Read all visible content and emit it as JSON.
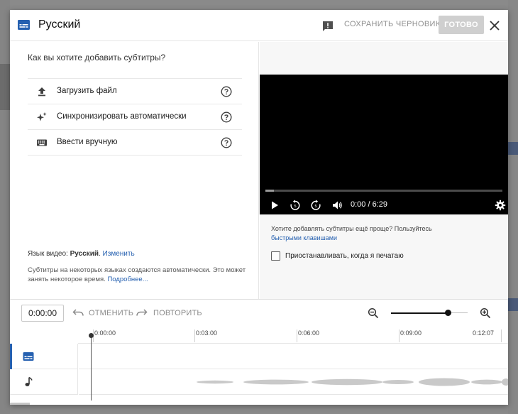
{
  "header": {
    "title": "Русский",
    "save_draft_label": "СОХРАНИТЬ ЧЕРНОВИК",
    "done_label": "ГОТОВО"
  },
  "left_pane": {
    "question": "Как вы хотите добавить субтитры?",
    "options": [
      {
        "label": "Загрузить файл",
        "icon": "upload-icon"
      },
      {
        "label": "Синхронизировать автоматически",
        "icon": "sparkle-icon"
      },
      {
        "label": "Ввести вручную",
        "icon": "keyboard-icon"
      }
    ],
    "video_language_prefix": "Язык видео:",
    "video_language": "Русский",
    "change_link": "Изменить",
    "auto_note": "Субтитры на некоторых языках создаются автоматически. Это может занять некоторое время.",
    "learn_more_link": "Подробнее..."
  },
  "player": {
    "time_display": "0:00 / 6:29",
    "progress_fraction": 0.0,
    "hint_text": "Хотите добавлять субтитры ещё проще? Пользуйтесь",
    "hint_link": "быстрыми клавишами",
    "pause_checkbox_label": "Приостанавливать, когда я печатаю",
    "pause_checked": false
  },
  "timeline": {
    "current_time": "0:00:00",
    "undo_label": "ОТМЕНИТЬ",
    "redo_label": "ПОВТОРИТЬ",
    "ruler_labels": [
      "0:00:00",
      "0:03:00",
      "0:06:00",
      "0:09:00",
      "0:12:07"
    ],
    "zoom_fraction": 0.75
  },
  "colors": {
    "accent": "#2560b0",
    "done_disabled": "#cfcfcf",
    "video_bg": "#000000"
  }
}
